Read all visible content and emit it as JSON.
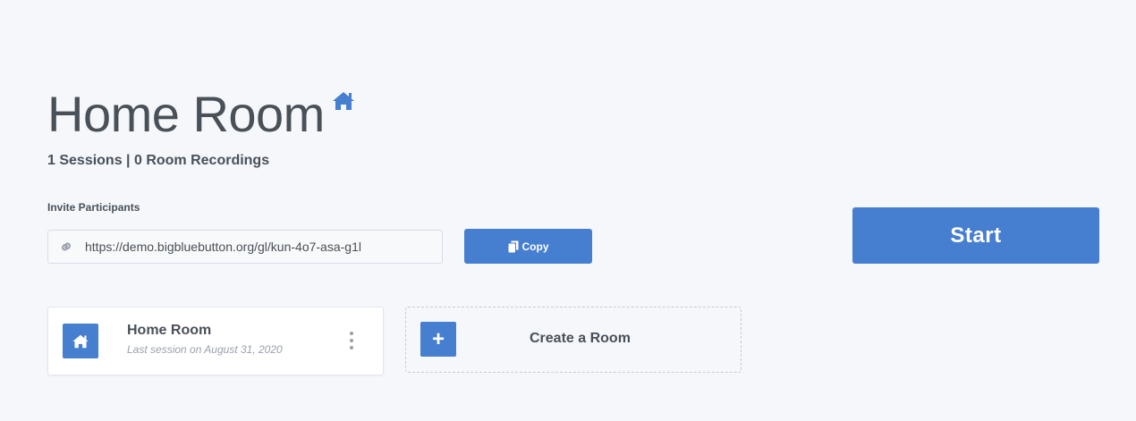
{
  "room": {
    "title": "Home Room",
    "stats": "1 Sessions | 0 Room Recordings"
  },
  "invite": {
    "label": "Invite Participants",
    "url": "https://demo.bigbluebutton.org/gl/kun-4o7-asa-g1l",
    "copy_label": "Copy"
  },
  "actions": {
    "start_label": "Start"
  },
  "room_cards": [
    {
      "name": "Home Room",
      "last_session": "Last session on August 31, 2020"
    }
  ],
  "create_room": {
    "icon_glyph": "+",
    "label": "Create a Room"
  },
  "colors": {
    "accent": "#467fcf",
    "text": "#495057",
    "muted": "#9aa0ac",
    "background": "#f5f7fb"
  },
  "icons": {
    "title": "home-icon",
    "invite": "link-icon",
    "copy": "copy-icon",
    "room_card": "home-icon",
    "room_menu": "more-vertical-icon"
  }
}
